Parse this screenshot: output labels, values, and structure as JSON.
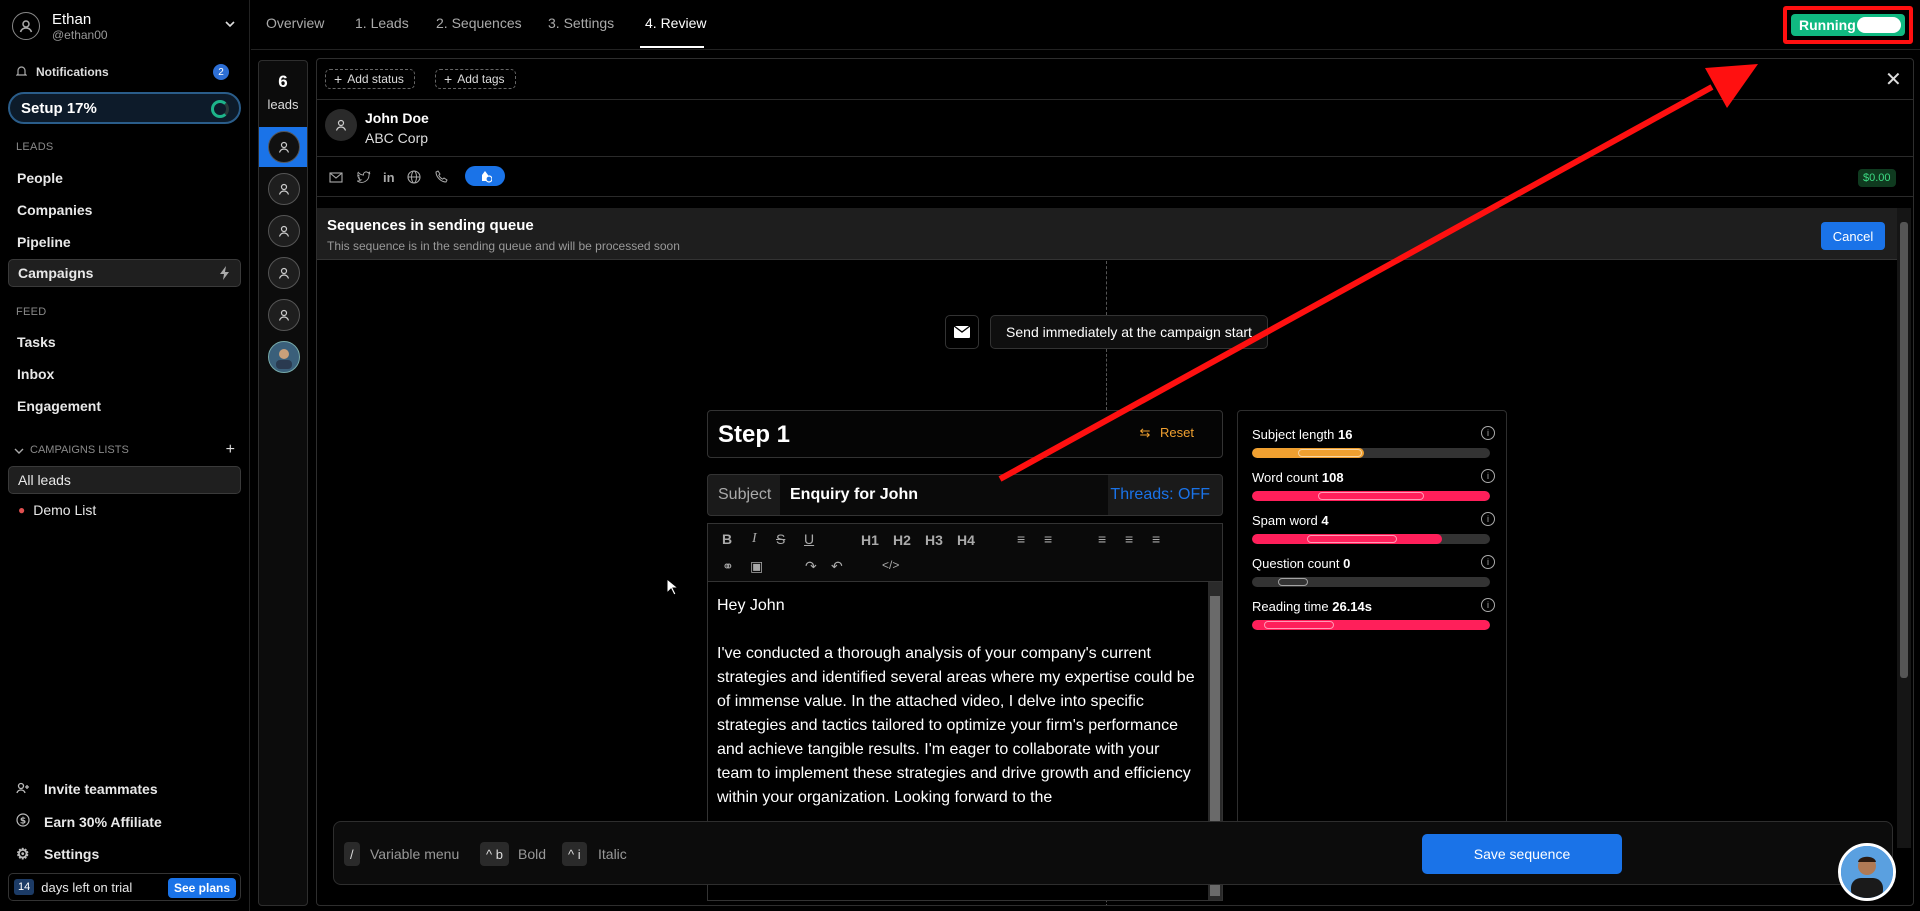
{
  "user": {
    "name": "Ethan",
    "handle": "@ethan00"
  },
  "sidebar": {
    "notifications_label": "Notifications",
    "notifications_count": "2",
    "setup_label": "Setup 17%",
    "leads_heading": "LEADS",
    "leads_items": [
      "People",
      "Companies",
      "Pipeline",
      "Campaigns"
    ],
    "feed_heading": "FEED",
    "feed_items": [
      "Tasks",
      "Inbox",
      "Engagement"
    ],
    "campaign_lists_heading": "CAMPAIGNS LISTS",
    "all_leads": "All leads",
    "demo_list": "Demo List",
    "invite": "Invite teammates",
    "affiliate": "Earn 30% Affiliate",
    "settings": "Settings",
    "trial_days": "14",
    "trial_text": "days left on trial",
    "see_plans": "See plans"
  },
  "tabs": [
    "Overview",
    "1. Leads",
    "2. Sequences",
    "3. Settings",
    "4. Review"
  ],
  "status": {
    "label": "Running",
    "on": true
  },
  "leads_column": {
    "count": "6",
    "label": "leads"
  },
  "contact": {
    "add_status": "Add status",
    "add_tags": "Add tags",
    "name": "John Doe",
    "company": "ABC Corp",
    "price": "$0.00"
  },
  "queue": {
    "title": "Sequences in sending queue",
    "subtitle": "This sequence is in the sending queue and will be processed soon",
    "cancel": "Cancel"
  },
  "send_step": "Send immediately at the campaign start",
  "step": {
    "title": "Step 1",
    "reset": "Reset",
    "subject_label": "Subject",
    "subject_value": "Enquiry for John",
    "threads": "Threads: OFF",
    "toolbar_headings": [
      "H1",
      "H2",
      "H3",
      "H4"
    ],
    "greeting": "Hey John",
    "body": "I've conducted a thorough analysis of your company's current strategies and identified several areas where my expertise could be of immense value. In the attached video, I delve into specific strategies and tactics tailored to optimize your firm's performance and achieve tangible results. I'm eager to collaborate with your team to implement these strategies and drive growth and efficiency within your organization. Looking forward to the"
  },
  "metrics": [
    {
      "label": "Subject length",
      "value": "16",
      "fill": 0.47,
      "color": "#f0a030"
    },
    {
      "label": "Word count",
      "value": "108",
      "fill": 1.0,
      "color": "#ff1f5a"
    },
    {
      "label": "Spam word",
      "value": "4",
      "fill": 0.8,
      "color": "#ff1f5a"
    },
    {
      "label": "Question count",
      "value": "0",
      "fill": 0.0,
      "color": "#ff1f5a"
    },
    {
      "label": "Reading time",
      "value": "26.14s",
      "fill": 1.0,
      "color": "#ff1f5a"
    }
  ],
  "shortcuts": [
    {
      "key": "/",
      "label": "Variable menu"
    },
    {
      "key": "^ b",
      "label": "Bold"
    },
    {
      "key": "^ i",
      "label": "Italic"
    }
  ],
  "save_label": "Save sequence",
  "colors": {
    "accent": "#1a73e8",
    "running": "#10b981",
    "annotation": "#ff1010"
  }
}
